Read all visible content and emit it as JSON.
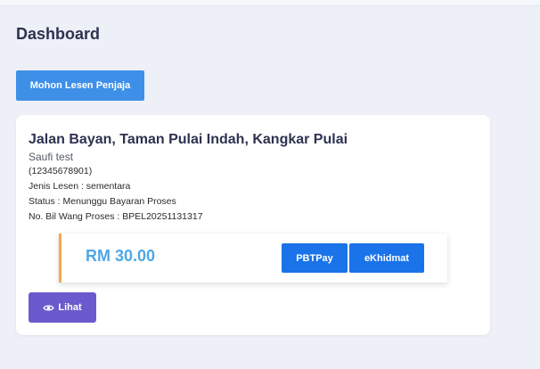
{
  "page": {
    "title": "Dashboard"
  },
  "actions": {
    "apply_label": "Mohon Lesen Penjaja"
  },
  "license_card": {
    "address": "Jalan Bayan, Taman Pulai Indah, Kangkar Pulai",
    "owner": "Saufi test",
    "ic_number": "(12345678901)",
    "license_type": "Jenis Lesen : sementara",
    "status": "Status : Menunggu Bayaran Proses",
    "bill_number": "No. Bil Wang Proses : BPEL20251131317",
    "payment": {
      "amount": "RM 30.00",
      "pbtpay_label": "PBTPay",
      "ekhidmat_label": "eKhidmat"
    },
    "view_label": "Lihat"
  },
  "colors": {
    "background": "#eef0f7",
    "primary_button": "#3d8fe8",
    "pay_button": "#1a73e8",
    "view_button": "#6a5acd",
    "amount_text": "#4ea7e6",
    "accent_border": "#f3a94a"
  },
  "icons": {
    "view": "eye-icon"
  }
}
